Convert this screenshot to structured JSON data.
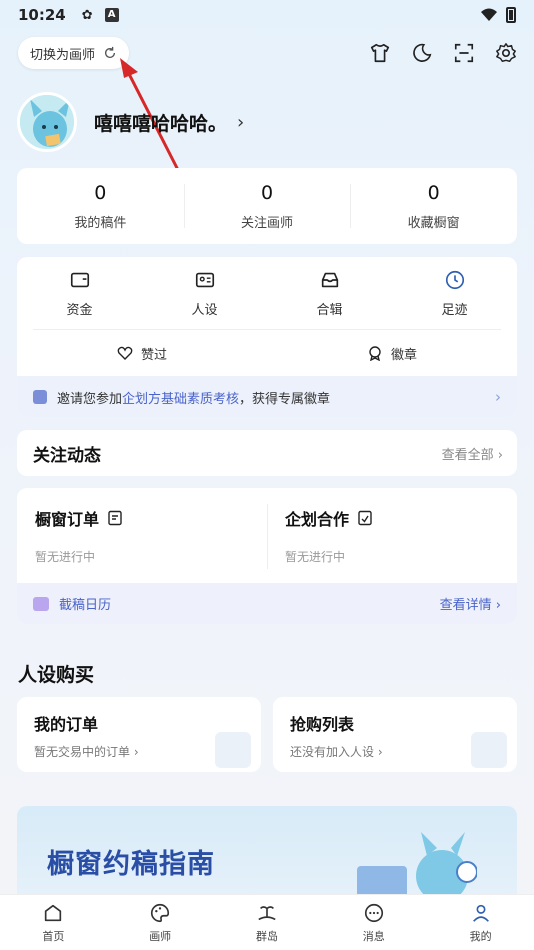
{
  "status_bar": {
    "time": "10:24",
    "keyboard_icon": "A"
  },
  "header": {
    "switch_label": "切换为画师"
  },
  "profile": {
    "username": "嘻嘻嘻哈哈哈。",
    "chevron": "›"
  },
  "stats": [
    {
      "value": "0",
      "label": "我的稿件"
    },
    {
      "value": "0",
      "label": "关注画师"
    },
    {
      "value": "0",
      "label": "收藏橱窗"
    }
  ],
  "tools": {
    "row1": [
      {
        "label": "资金",
        "icon": "wallet-icon"
      },
      {
        "label": "人设",
        "icon": "id-card-icon"
      },
      {
        "label": "合辑",
        "icon": "inbox-icon"
      },
      {
        "label": "足迹",
        "icon": "clock-icon"
      }
    ],
    "row2": [
      {
        "label": "赞过",
        "icon": "heart-icon"
      },
      {
        "label": "徽章",
        "icon": "medal-icon"
      }
    ],
    "invite": {
      "prefix": "邀请您参加 ",
      "link": "企划方基础素质考核",
      "suffix": "，获得专属徽章"
    }
  },
  "follow": {
    "title": "关注动态",
    "more": "查看全部 ›"
  },
  "orders": {
    "left": {
      "title": "橱窗订单",
      "sub": "暂无进行中"
    },
    "right": {
      "title": "企划合作",
      "sub": "暂无进行中"
    },
    "calendar": {
      "label": "截稿日历",
      "more": "查看详情 ›"
    }
  },
  "persona_section": {
    "title": "人设购买",
    "cards": [
      {
        "title": "我的订单",
        "sub": "暂无交易中的订单 ›"
      },
      {
        "title": "抢购列表",
        "sub": "还没有加入人设 ›"
      }
    ]
  },
  "guide": {
    "title": "橱窗约稿指南"
  },
  "tabbar": [
    {
      "label": "首页",
      "icon": "home-icon"
    },
    {
      "label": "画师",
      "icon": "palette-icon"
    },
    {
      "label": "群岛",
      "icon": "island-icon"
    },
    {
      "label": "消息",
      "icon": "message-icon"
    },
    {
      "label": "我的",
      "icon": "user-icon"
    }
  ],
  "colors": {
    "accent": "#4a63c9",
    "guide_title": "#2a4ea5",
    "arrow": "#d62828"
  }
}
